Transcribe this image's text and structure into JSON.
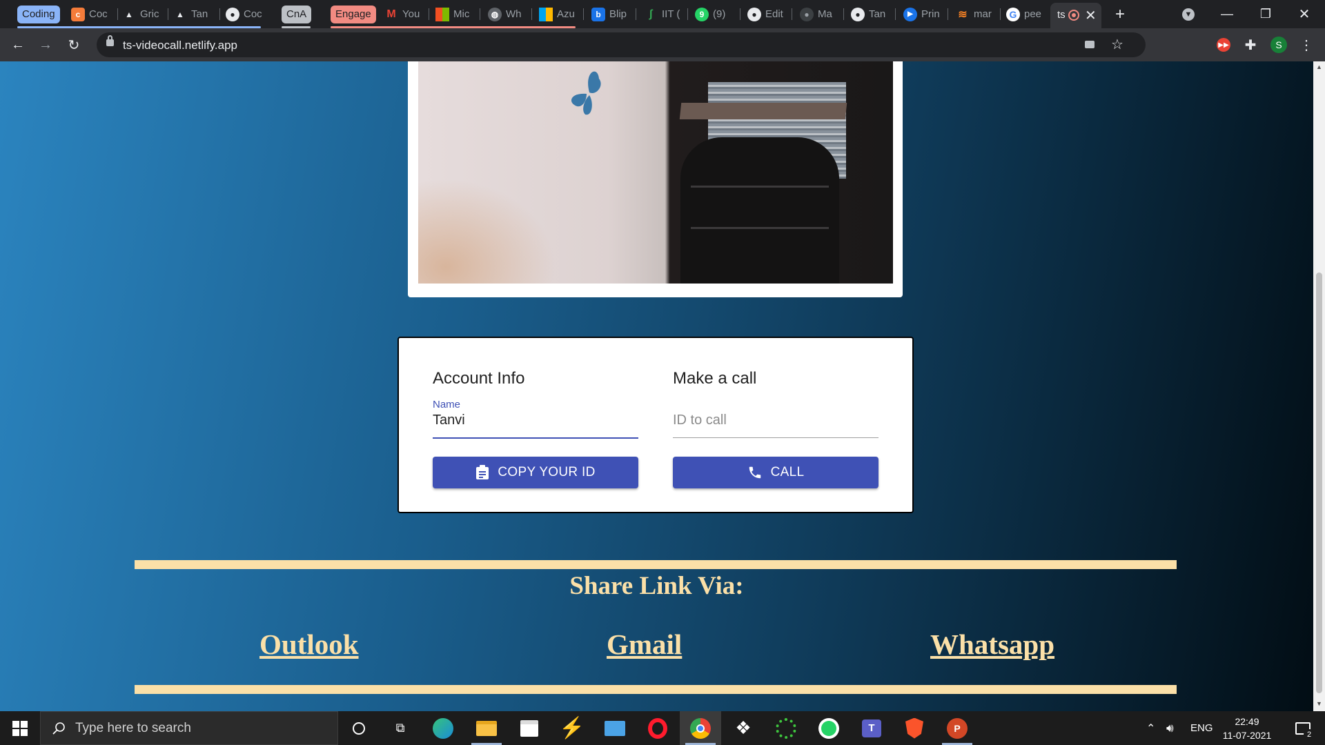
{
  "browser": {
    "tabs": [
      {
        "label": "Coding",
        "kind": "group",
        "color": "#8ab4f8"
      },
      {
        "label": "Coc",
        "icon": "codechef-icon"
      },
      {
        "label": "Gric",
        "icon": "mountain-icon"
      },
      {
        "label": "Tan",
        "icon": "mountain-icon"
      },
      {
        "label": "Coc",
        "icon": "github-icon"
      },
      {
        "label": "CnA",
        "kind": "group",
        "color": "#bdc1c6"
      },
      {
        "label": "Engage",
        "kind": "group",
        "color": "#f28b82"
      },
      {
        "label": "You",
        "icon": "gmail-icon"
      },
      {
        "label": "Mic",
        "icon": "microsoft-icon"
      },
      {
        "label": "Wh",
        "icon": "globe-icon"
      },
      {
        "label": "Azu",
        "icon": "microsoft-icon"
      },
      {
        "label": "Blip",
        "icon": "blip-icon"
      },
      {
        "label": "IIT (",
        "icon": "leaf-icon"
      },
      {
        "label": "(9)",
        "icon": "whatsapp-icon"
      },
      {
        "label": "Edit",
        "icon": "github-icon"
      },
      {
        "label": "Ma",
        "icon": "github-icon"
      },
      {
        "label": "Tan",
        "icon": "github-icon"
      },
      {
        "label": "Prin",
        "icon": "play-icon"
      },
      {
        "label": "mar",
        "icon": "stack-icon"
      },
      {
        "label": "pee",
        "icon": "google-icon"
      },
      {
        "label": "ts",
        "icon": "recording-icon",
        "active": true
      }
    ],
    "url": "ts-videocall.netlify.app",
    "profile_initial": "S"
  },
  "page": {
    "account_title": "Account Info",
    "name_label": "Name",
    "name_value": "Tanvi",
    "copy_button": "COPY YOUR ID",
    "call_title": "Make a call",
    "id_placeholder": "ID to call",
    "call_button": "CALL",
    "share_title": "Share Link Via:",
    "share_links": [
      "Outlook",
      "Gmail",
      "Whatsapp"
    ],
    "accent_color": "#3f51b5",
    "share_color": "#fbe0a8"
  },
  "taskbar": {
    "search_placeholder": "Type here to search",
    "language": "ENG",
    "time": "22:49",
    "date": "11-07-2021",
    "notification_count": "2"
  }
}
